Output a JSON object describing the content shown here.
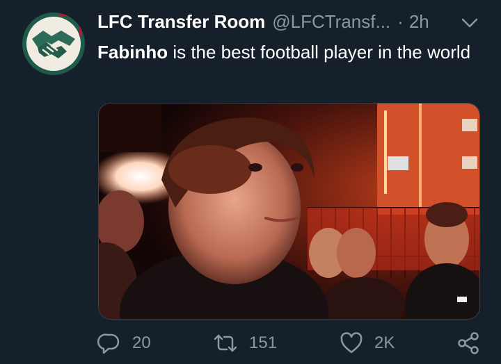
{
  "tweet": {
    "display_name": "LFC Transfer Room",
    "handle": "@LFCTransf...",
    "separator": "·",
    "time": "2h",
    "text_bold": "Fabinho",
    "text_rest": " is the best football player in the world"
  },
  "actions": {
    "replies": "20",
    "retweets": "151",
    "likes": "2K"
  },
  "colors": {
    "background": "#15202b",
    "secondary_text": "#8899a6",
    "avatar_green": "#1f5a4a"
  },
  "icons": [
    "chevron-down-icon",
    "reply-icon",
    "retweet-icon",
    "like-icon",
    "share-icon"
  ]
}
